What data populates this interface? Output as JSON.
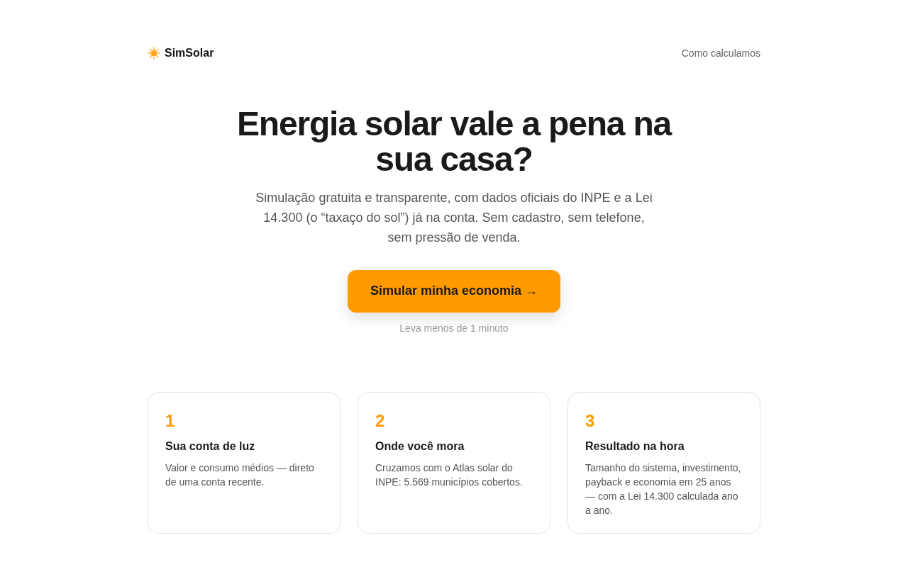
{
  "header": {
    "logo": "SimSolar",
    "nav_link": "Como calculamos"
  },
  "hero": {
    "title": "Energia solar vale a pena na sua casa?",
    "subtitle": "Simulação gratuita e transparente, com dados oficiais do INPE e a Lei 14.300 (o “taxaço do sol”) já na conta. Sem cadastro, sem telefone, sem pressão de venda.",
    "cta_button": "Simular minha economia →",
    "cta_note": "Leva menos de 1 minuto"
  },
  "steps": [
    {
      "number": "1",
      "title": "Sua conta de luz",
      "description": "Valor e consumo médios — direto de uma conta recente."
    },
    {
      "number": "2",
      "title": "Onde você mora",
      "description": "Cruzamos com o Atlas solar do INPE: 5.569 municípios cobertos."
    },
    {
      "number": "3",
      "title": "Resultado na hora",
      "description": "Tamanho do sistema, investimento, payback e economia em 25 anos — com a Lei 14.300 calculada ano a ano."
    }
  ]
}
